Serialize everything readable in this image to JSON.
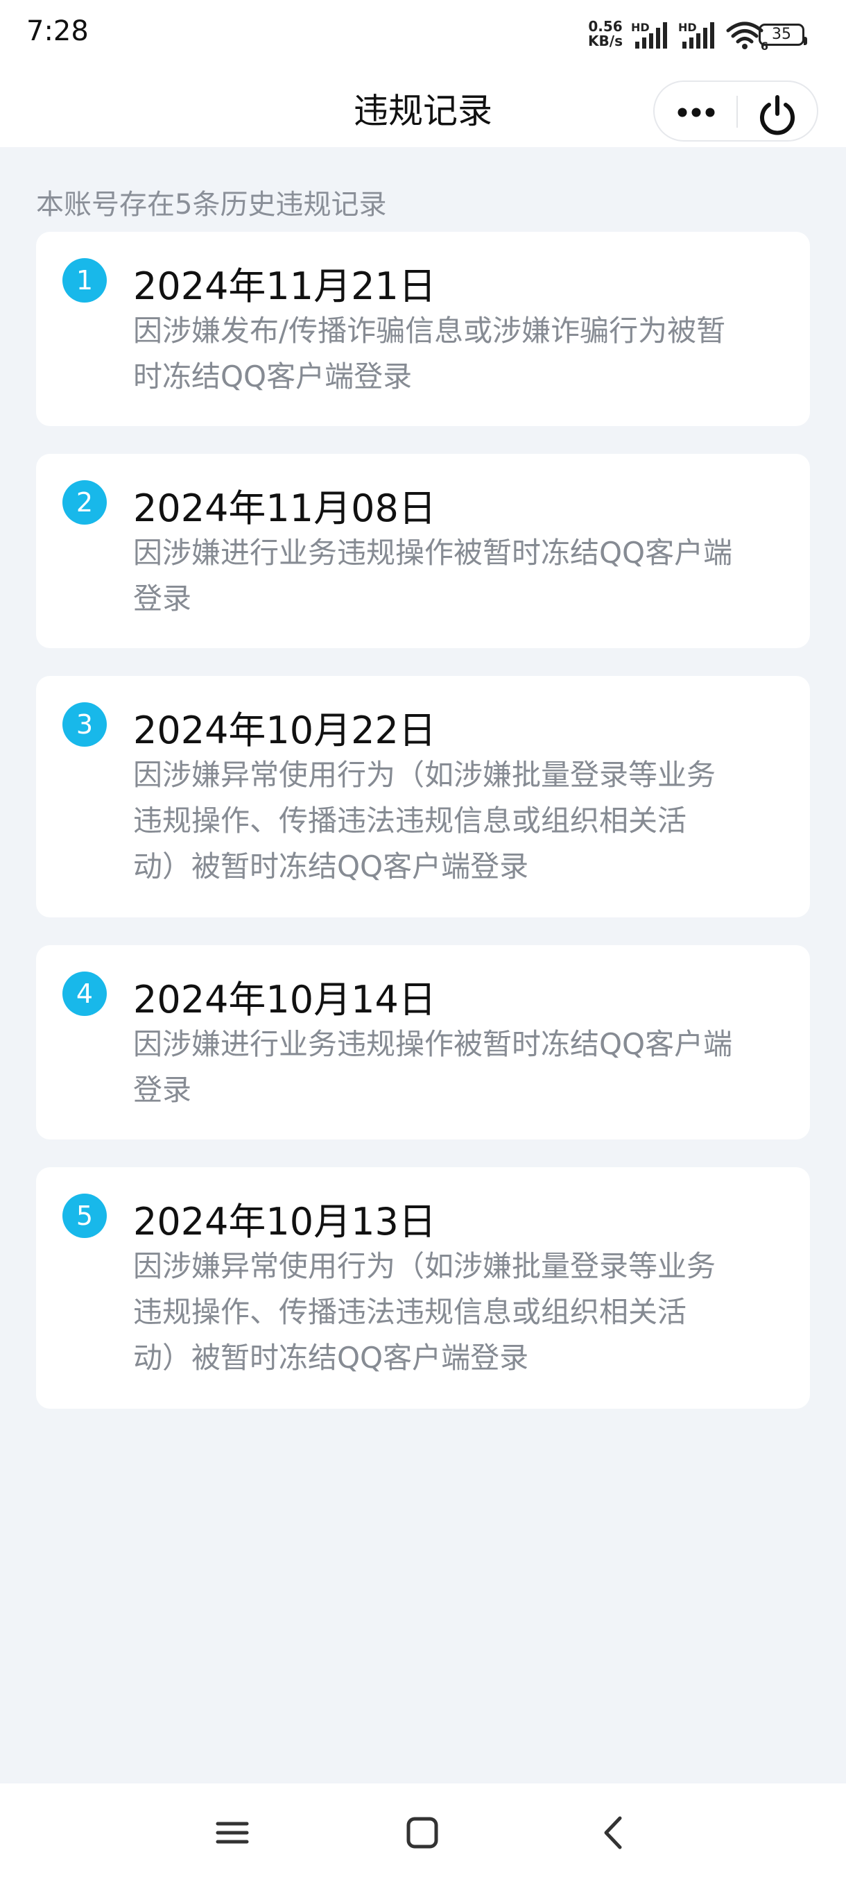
{
  "status_bar": {
    "time": "7:28",
    "net_speed_value": "0.56",
    "net_speed_unit": "KB/s",
    "signal_label": "HD",
    "wifi_badge": "6",
    "battery_level": "35",
    "icons": [
      "signal-icon",
      "signal-icon",
      "wifi-icon",
      "battery-icon"
    ]
  },
  "header": {
    "title": "违规记录",
    "more_icon": "more-dots-icon",
    "power_icon": "power-icon"
  },
  "summary": "本账号存在5条历史违规记录",
  "records": [
    {
      "num": "1",
      "date": "2024年11月21日",
      "lines": [
        "因涉嫌发布/传播诈骗信息或涉嫌诈骗行为被暂",
        "时冻结QQ客户端登录"
      ]
    },
    {
      "num": "2",
      "date": "2024年11月08日",
      "lines": [
        "因涉嫌进行业务违规操作被暂时冻结QQ客户端",
        "登录"
      ]
    },
    {
      "num": "3",
      "date": "2024年10月22日",
      "lines": [
        "因涉嫌异常使用行为（如涉嫌批量登录等业务",
        "违规操作、传播违法违规信息或组织相关活",
        "动）被暂时冻结QQ客户端登录"
      ]
    },
    {
      "num": "4",
      "date": "2024年10月14日",
      "lines": [
        "因涉嫌进行业务违规操作被暂时冻结QQ客户端",
        "登录"
      ]
    },
    {
      "num": "5",
      "date": "2024年10月13日",
      "lines": [
        "因涉嫌异常使用行为（如涉嫌批量登录等业务",
        "违规操作、传播违法违规信息或组织相关活",
        "动）被暂时冻结QQ客户端登录"
      ]
    }
  ],
  "nav": {
    "icons": [
      "menu-icon",
      "home-icon",
      "back-icon"
    ]
  },
  "colors": {
    "accent": "#18b8ea",
    "background": "#f1f4f8",
    "card": "#ffffff",
    "secondary_text": "#868b93"
  }
}
